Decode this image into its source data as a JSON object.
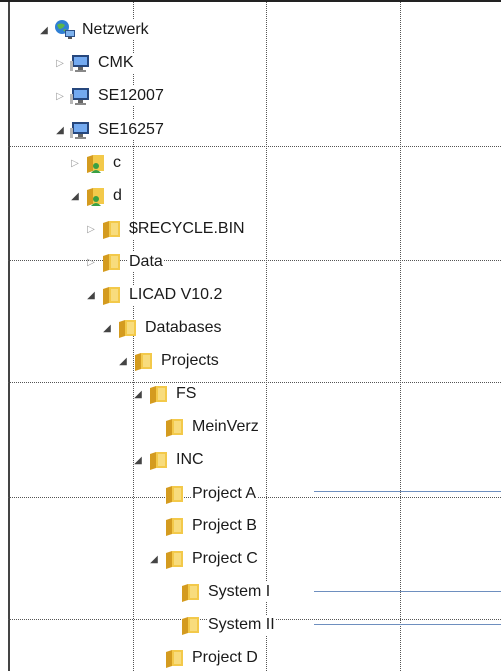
{
  "tree": {
    "root": {
      "label": "Netzwerk",
      "icon": "network-globe-icon",
      "state": "expanded"
    },
    "computers": [
      {
        "label": "CMK",
        "icon": "computer-icon",
        "state": "collapsed"
      },
      {
        "label": "SE12007",
        "icon": "computer-icon",
        "state": "collapsed"
      },
      {
        "label": "SE16257",
        "icon": "computer-icon",
        "state": "expanded"
      }
    ],
    "shares": [
      {
        "label": "c",
        "icon": "shared-folder-icon",
        "state": "collapsed"
      },
      {
        "label": "d",
        "icon": "shared-folder-icon",
        "state": "expanded"
      }
    ],
    "d_children": [
      {
        "label": "$RECYCLE.BIN",
        "icon": "folder-icon",
        "state": "collapsed"
      },
      {
        "label": "Data",
        "icon": "folder-icon",
        "state": "collapsed"
      },
      {
        "label": "LICAD V10.2",
        "icon": "folder-icon",
        "state": "expanded"
      }
    ],
    "licad_children": [
      {
        "label": "Databases",
        "icon": "folder-icon",
        "state": "expanded"
      }
    ],
    "databases_children": [
      {
        "label": "Projects",
        "icon": "folder-icon",
        "state": "expanded"
      }
    ],
    "projects_children": [
      {
        "label": "FS",
        "icon": "folder-icon",
        "state": "expanded"
      },
      {
        "label": "INC",
        "icon": "folder-icon",
        "state": "expanded"
      }
    ],
    "fs_children": [
      {
        "label": "MeinVerz",
        "icon": "folder-icon",
        "state": "leaf"
      }
    ],
    "inc_children": [
      {
        "label": "Project A",
        "icon": "folder-icon",
        "state": "leaf"
      },
      {
        "label": "Project B",
        "icon": "folder-icon",
        "state": "leaf"
      },
      {
        "label": "Project C",
        "icon": "folder-icon",
        "state": "expanded"
      },
      {
        "label": "Project D",
        "icon": "folder-icon",
        "state": "leaf"
      }
    ],
    "projectc_children": [
      {
        "label": "System I",
        "icon": "folder-icon",
        "state": "leaf"
      },
      {
        "label": "System II",
        "icon": "folder-icon",
        "state": "leaf"
      }
    ]
  },
  "colors": {
    "folder_yellow": "#f3c94a",
    "folder_dark": "#d49b1f",
    "annotation_line": "#6e8fbf",
    "grid_dots": "#555555"
  }
}
